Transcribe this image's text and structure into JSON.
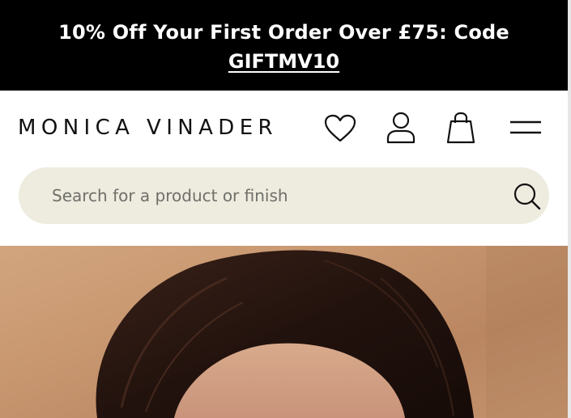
{
  "promo": {
    "text": "10% Off Your First Order Over £75: Code",
    "code": "GIFTMV10"
  },
  "header": {
    "logo": "MONICA VINADER",
    "icons": {
      "wishlist": "heart-icon",
      "account": "user-icon",
      "bag": "shopping-bag-icon",
      "menu": "hamburger-menu-icon"
    }
  },
  "search": {
    "placeholder": "Search for a product or finish",
    "value": "",
    "icon": "search-icon"
  },
  "hero": {
    "image": "woman-dark-hair-photo"
  },
  "colors": {
    "promo_bg": "#000000",
    "search_bg": "#eeebdf",
    "text": "#111111"
  }
}
